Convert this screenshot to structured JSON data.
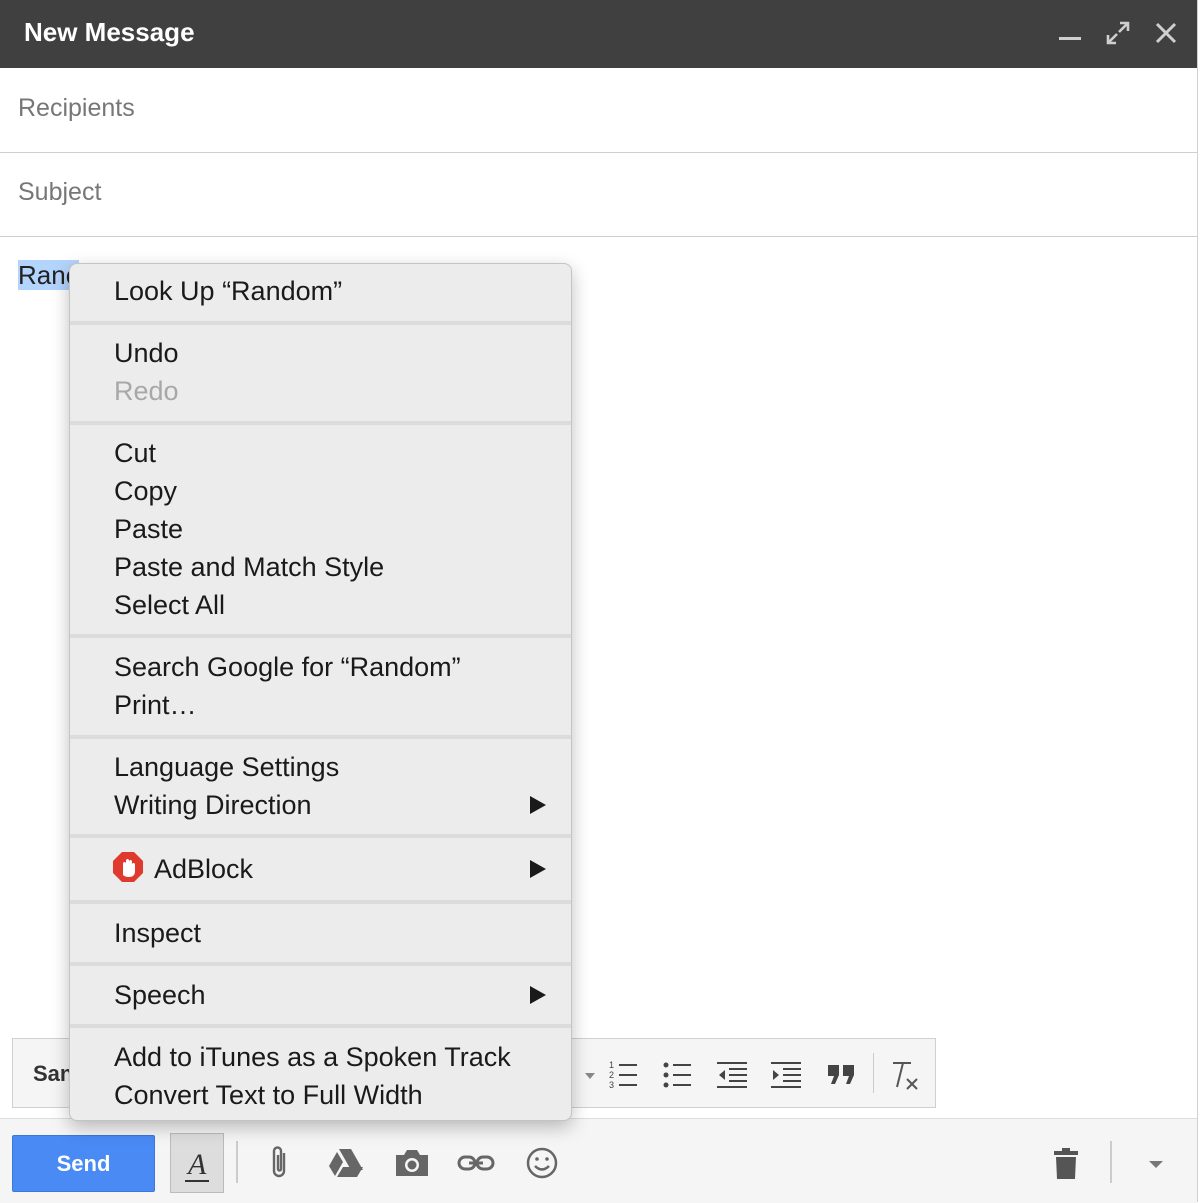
{
  "window": {
    "title": "New Message",
    "recipients_placeholder": "Recipients",
    "subject_placeholder": "Subject",
    "body_selected_text": "Ranc"
  },
  "format_toolbar": {
    "font_label": "San"
  },
  "bottom_toolbar": {
    "send_label": "Send",
    "format_toggle_label": "A"
  },
  "context_menu": {
    "look_up": "Look Up “Random”",
    "undo": "Undo",
    "redo": "Redo",
    "cut": "Cut",
    "copy": "Copy",
    "paste": "Paste",
    "paste_match": "Paste and Match Style",
    "select_all": "Select All",
    "search_google": "Search Google for “Random”",
    "print": "Print…",
    "language_settings": "Language Settings",
    "writing_direction": "Writing Direction",
    "adblock": "AdBlock",
    "inspect": "Inspect",
    "speech": "Speech",
    "add_itunes": "Add to iTunes as a Spoken Track",
    "convert_full_width": "Convert Text to Full Width"
  },
  "colors": {
    "titlebar": "#404040",
    "send_button": "#4a8af4",
    "selection": "#b3d4fc",
    "adblock_red": "#e03a2f"
  }
}
